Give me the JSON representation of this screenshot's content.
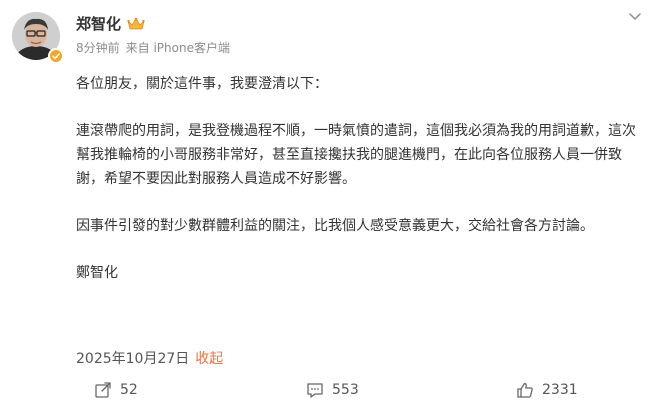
{
  "author": {
    "name": "郑智化"
  },
  "meta": {
    "time": "8分钟前",
    "source": "来自 iPhone客户端"
  },
  "post": {
    "paragraphs": [
      "各位朋友，關於這件事，我要澄清以下：",
      "連滾帶爬的用詞，是我登機過程不順，一時氣憤的遣詞，這個我必須為我的用詞道歉，這次幫我推輪椅的小哥服務非常好，甚至直接攙扶我的腿進機門，在此向各位服務人員一併致謝，希望不要因此對服務人員造成不好影響。",
      "因事件引發的對少數群體利益的關注，比我個人感受意義更大，交給社會各方討論。",
      "鄭智化"
    ]
  },
  "footer": {
    "date": "2025年10月27日",
    "collapse_label": "收起"
  },
  "actions": {
    "repost_count": "52",
    "comment_count": "553",
    "like_count": "2331"
  },
  "icons": {
    "verified": "verified-badge-icon",
    "crown": "crown-badge-icon",
    "chevron": "chevron-down-icon",
    "repost": "repost-icon",
    "comment": "comment-icon",
    "like": "thumbs-up-icon"
  },
  "colors": {
    "collapse_link": "#eb7340",
    "verified_badge": "#f5a623"
  }
}
